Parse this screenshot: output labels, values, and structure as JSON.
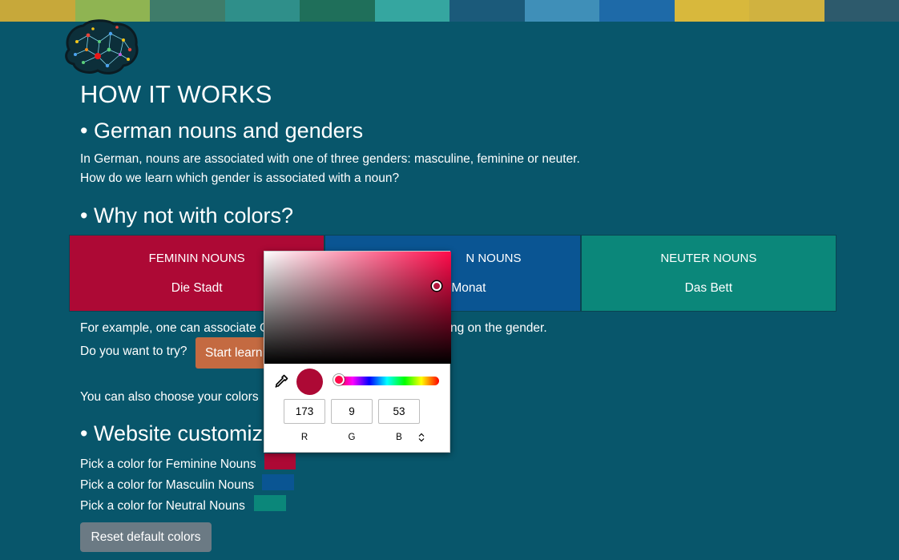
{
  "banner": {
    "colors": [
      "#c7a83a",
      "#8fb452",
      "#3f7c6a",
      "#2f8f8a",
      "#1f6f5a",
      "#35a6a0",
      "#1b5a7a",
      "#3f8fb8",
      "#1e6aa8",
      "#d8b83c",
      "#d0b240",
      "#2d5a6c"
    ]
  },
  "logo": {
    "icon": "brain-network-icon"
  },
  "page": {
    "title": "HOW IT WORKS",
    "section1_heading": "• German nouns and genders",
    "intro_line1": "In German, nouns are associated with one of three genders: masculine, feminine or neuter.",
    "intro_line2": "How do we learn which gender is associated with a noun?",
    "section2_heading": "• Why not with colors?",
    "example_line_a": "For example, one can associate C",
    "example_line_b": "ng on the gender.",
    "try_text": "Do you want to try?",
    "start_button": "Start learn",
    "choose_text": "You can also choose your colors",
    "section3_heading": "• Website customiza",
    "pick_feminine": "Pick a color for Feminine Nouns",
    "pick_masculin": "Pick a color for Masculin Nouns",
    "pick_neutral": "Pick a color for Neutral Nouns",
    "reset_button": "Reset default colors"
  },
  "cards": [
    {
      "title": "FEMININ NOUNS",
      "word": "Die Stadt",
      "color": "#ad0935"
    },
    {
      "title": "N NOUNS",
      "word": "Monat",
      "color": "#0a5593"
    },
    {
      "title": "NEUTER NOUNS",
      "word": "Das Bett",
      "color": "#0b877a"
    }
  ],
  "swatches": {
    "feminine": "#ad0935",
    "masculin": "#0a5593",
    "neutral": "#0b877a"
  },
  "picker": {
    "hue_color": "#ff0a4a",
    "preview_color": "#ad0935",
    "eyedropper_icon": "eyedropper-icon",
    "r": "173",
    "g": "9",
    "b": "53",
    "r_label": "R",
    "g_label": "G",
    "b_label": "B",
    "toggle_glyph": "⌃⌄"
  }
}
